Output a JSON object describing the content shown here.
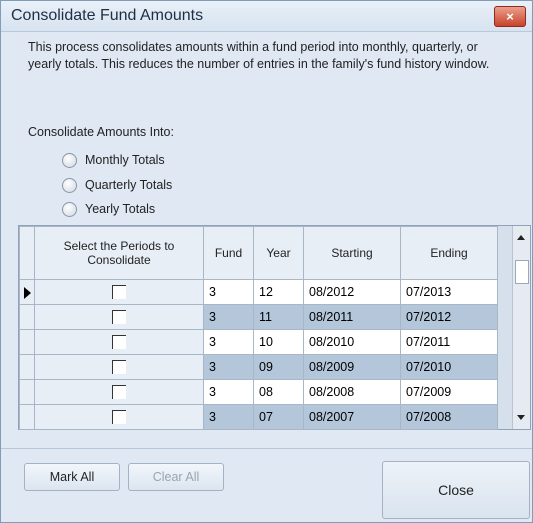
{
  "dialog": {
    "title": "Consolidate Fund Amounts",
    "close_icon": "×",
    "description": "This process consolidates amounts within a fund period into monthly, quarterly, or yearly totals. This reduces the number of entries in the family's fund history window.",
    "consolidate_label": "Consolidate Amounts Into:",
    "options": [
      "Monthly Totals",
      "Quarterly Totals",
      "Yearly Totals"
    ]
  },
  "table": {
    "headers": {
      "select": "Select the Periods to Consolidate",
      "fund": "Fund",
      "year": "Year",
      "starting": "Starting",
      "ending": "Ending"
    },
    "rows": [
      {
        "fund": "3",
        "year": "12",
        "starting": "08/2012",
        "ending": "07/2013"
      },
      {
        "fund": "3",
        "year": "11",
        "starting": "08/2011",
        "ending": "07/2012"
      },
      {
        "fund": "3",
        "year": "10",
        "starting": "08/2010",
        "ending": "07/2011"
      },
      {
        "fund": "3",
        "year": "09",
        "starting": "08/2009",
        "ending": "07/2010"
      },
      {
        "fund": "3",
        "year": "08",
        "starting": "08/2008",
        "ending": "07/2009"
      },
      {
        "fund": "3",
        "year": "07",
        "starting": "08/2007",
        "ending": "07/2008"
      }
    ]
  },
  "buttons": {
    "mark_all": "Mark All",
    "clear_all": "Clear All",
    "close": "Close"
  }
}
